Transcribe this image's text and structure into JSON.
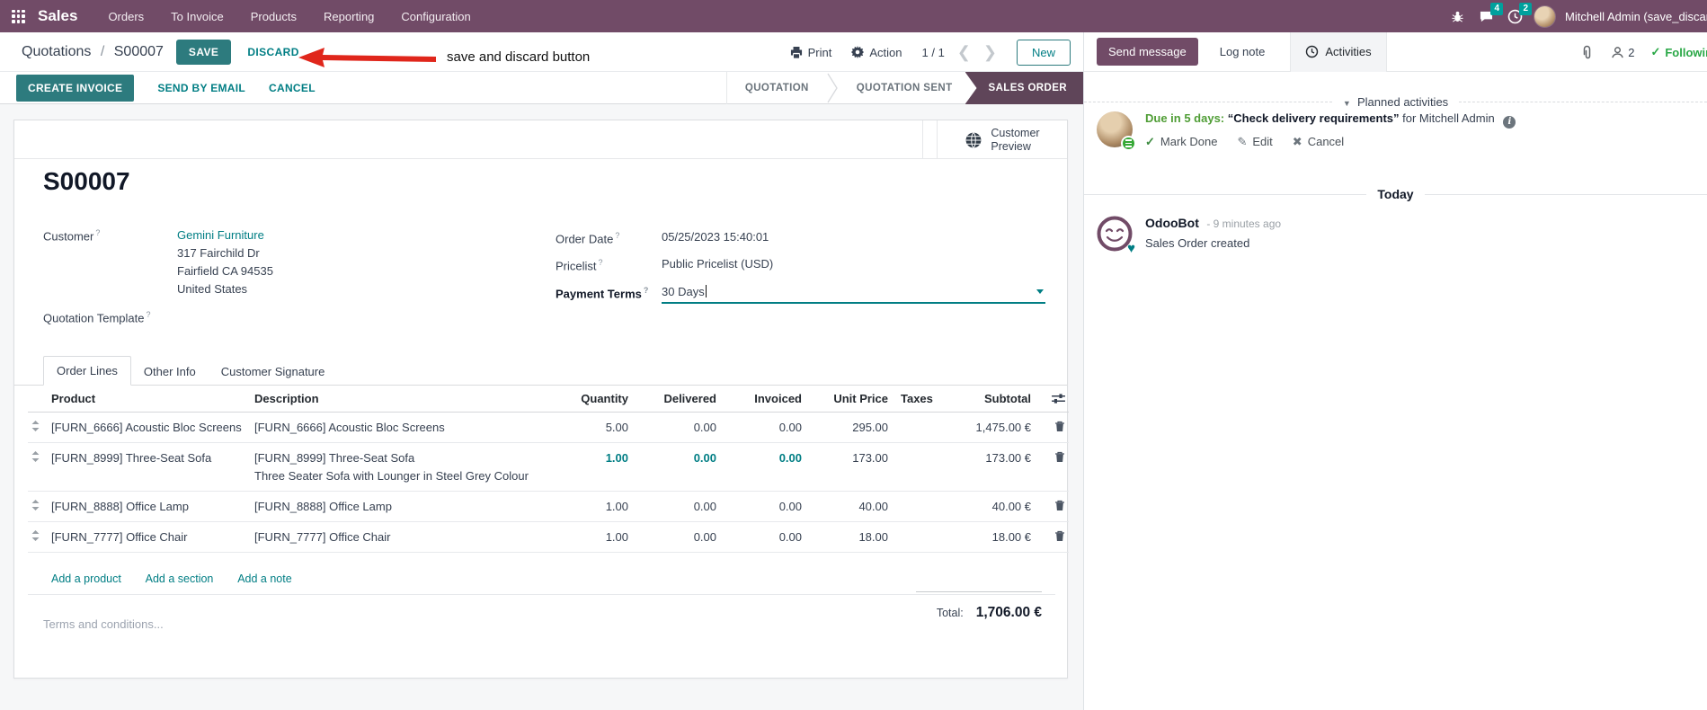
{
  "help_marker": "?",
  "colors": {
    "brand_purple": "#714B67",
    "stage_active_purple": "#5f4559",
    "button_teal": "#2d7b7e",
    "link_teal": "#017e84",
    "badge_teal": "#00A09D",
    "following_green": "#28a745",
    "due_green": "#4f9d35",
    "annotation_red": "#e0261b"
  },
  "nav": {
    "app": "Sales",
    "items": [
      {
        "label": "Orders"
      },
      {
        "label": "To Invoice"
      },
      {
        "label": "Products"
      },
      {
        "label": "Reporting"
      },
      {
        "label": "Configuration"
      }
    ],
    "message_count": "4",
    "activity_count": "2",
    "user": "Mitchell Admin (save_discar"
  },
  "control_panel": {
    "breadcrumb_parent": "Quotations",
    "breadcrumb_sep": "/",
    "breadcrumb_current": "S00007",
    "save": "SAVE",
    "discard": "DISCARD",
    "print": "Print",
    "action": "Action",
    "pager": "1 / 1",
    "prev": "❮",
    "next": "❯",
    "new": "New"
  },
  "annotation": {
    "text": "save and discard button"
  },
  "statusbar": {
    "buttons": [
      {
        "label": "CREATE INVOICE"
      },
      {
        "label": "SEND BY EMAIL"
      },
      {
        "label": "CANCEL"
      }
    ],
    "stages": [
      {
        "label": "QUOTATION"
      },
      {
        "label": "QUOTATION SENT"
      },
      {
        "label": "SALES ORDER"
      }
    ]
  },
  "sheet": {
    "preview_button": {
      "line1": "Customer",
      "line2": "Preview"
    },
    "title": "S00007",
    "fields": {
      "customer_label": "Customer",
      "customer_name": "Gemini Furniture",
      "address": [
        "317 Fairchild Dr",
        "Fairfield CA 94535",
        "United States"
      ],
      "quotation_template_label": "Quotation Template",
      "order_date_label": "Order Date",
      "order_date": "05/25/2023 15:40:01",
      "pricelist_label": "Pricelist",
      "pricelist": "Public Pricelist (USD)",
      "payment_terms_label": "Payment Terms",
      "payment_terms": "30 Days"
    },
    "tabs": [
      {
        "label": "Order Lines"
      },
      {
        "label": "Other Info"
      },
      {
        "label": "Customer Signature"
      }
    ],
    "table": {
      "headers": [
        "Product",
        "Description",
        "Quantity",
        "Delivered",
        "Invoiced",
        "Unit Price",
        "Taxes",
        "Subtotal"
      ],
      "rows": [
        {
          "product": "[FURN_6666] Acoustic Bloc Screens",
          "description": "[FURN_6666] Acoustic Bloc Screens",
          "quantity": "5.00",
          "delivered": "0.00",
          "invoiced": "0.00",
          "unit_price": "295.00",
          "taxes": "",
          "subtotal": "1,475.00 €"
        },
        {
          "product": "[FURN_8999] Three-Seat Sofa",
          "description": "[FURN_8999] Three-Seat Sofa",
          "description2": "Three Seater Sofa with Lounger in Steel Grey Colour",
          "quantity": "1.00",
          "delivered": "0.00",
          "invoiced": "0.00",
          "unit_price": "173.00",
          "taxes": "",
          "subtotal": "173.00 €"
        },
        {
          "product": "[FURN_8888] Office Lamp",
          "description": "[FURN_8888] Office Lamp",
          "quantity": "1.00",
          "delivered": "0.00",
          "invoiced": "0.00",
          "unit_price": "40.00",
          "taxes": "",
          "subtotal": "40.00 €"
        },
        {
          "product": "[FURN_7777] Office Chair",
          "description": "[FURN_7777] Office Chair",
          "quantity": "1.00",
          "delivered": "0.00",
          "invoiced": "0.00",
          "unit_price": "18.00",
          "taxes": "",
          "subtotal": "18.00 €"
        }
      ],
      "links": [
        {
          "label": "Add a product"
        },
        {
          "label": "Add a section"
        },
        {
          "label": "Add a note"
        }
      ]
    },
    "terms_placeholder": "Terms and conditions...",
    "total_label": "Total:",
    "total_value": "1,706.00 €"
  },
  "chatter": {
    "send_message": "Send message",
    "log_note": "Log note",
    "activities": "Activities",
    "follower_count": "2",
    "following": "Following",
    "planned": {
      "header": "Planned activities",
      "due": "Due in 5 days:",
      "task": "“Check delivery requirements”",
      "for_user": "for Mitchell Admin",
      "actions": [
        {
          "label": "Mark Done"
        },
        {
          "label": "Edit"
        },
        {
          "label": "Cancel"
        }
      ]
    },
    "today": "Today",
    "message": {
      "author": "OdooBot",
      "time": "- 9 minutes ago",
      "body": "Sales Order created"
    }
  }
}
